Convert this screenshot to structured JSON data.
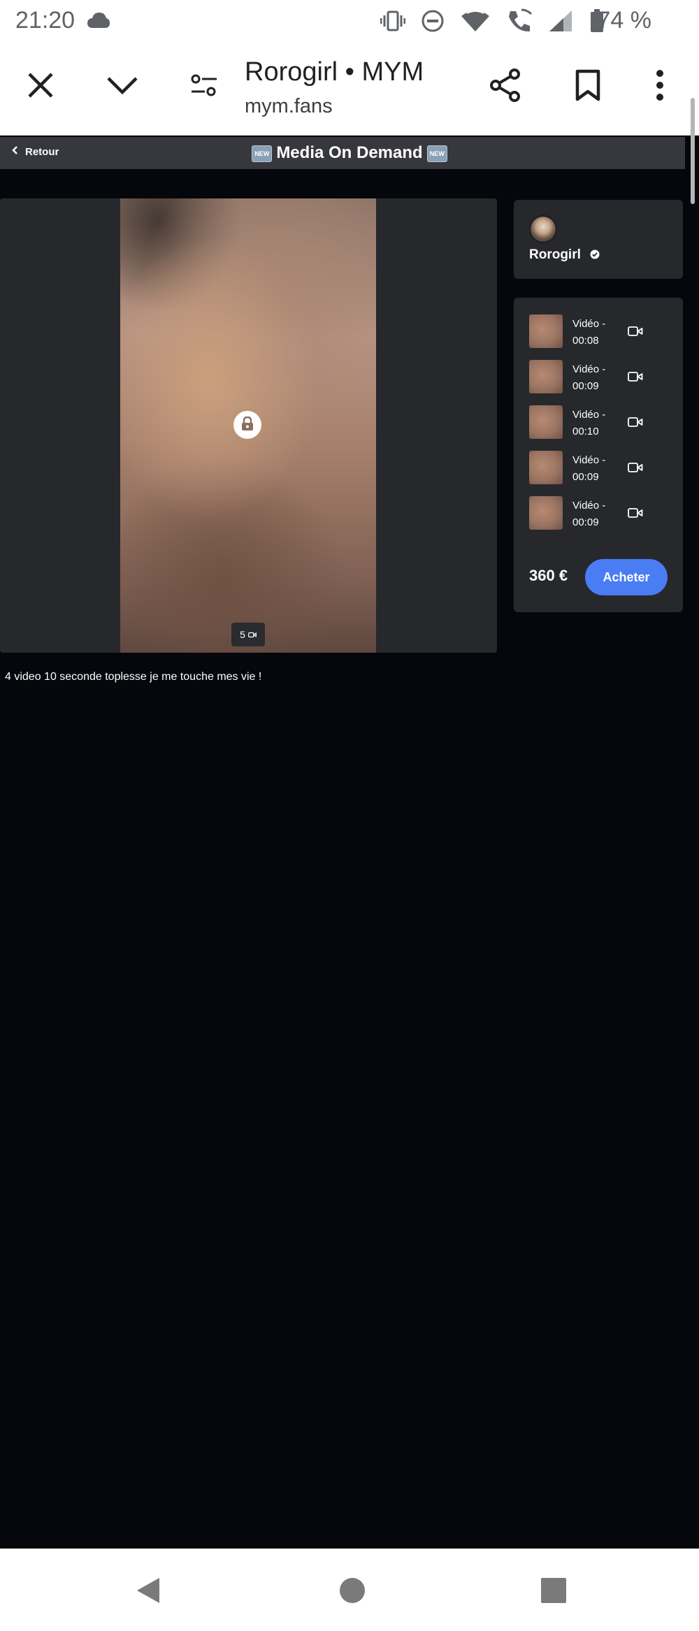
{
  "status_bar": {
    "time": "21:20",
    "battery_percent": "74 %",
    "icons": [
      "cloud-icon",
      "vibrate-icon",
      "do-not-disturb-icon",
      "wifi-icon",
      "wifi-calling-icon",
      "signal-icon",
      "battery-icon"
    ]
  },
  "toolbar": {
    "title": "Rorogirl • MYM",
    "url": "mym.fans",
    "icons": [
      "close-icon",
      "chevron-down-icon",
      "tune-icon",
      "share-icon",
      "bookmark-icon",
      "more-vert-icon"
    ]
  },
  "header": {
    "back_label": "Retour",
    "title": "Media On Demand",
    "badge_label": "NEW"
  },
  "media": {
    "count": "5"
  },
  "caption": "4 video 10 seconde toplesse je me touche mes vie !",
  "creator": {
    "name": "Rorogirl"
  },
  "items": [
    {
      "label": "Vidéo - 00:08"
    },
    {
      "label": "Vidéo - 00:09"
    },
    {
      "label": "Vidéo - 00:10"
    },
    {
      "label": "Vidéo - 00:09"
    },
    {
      "label": "Vidéo - 00:09"
    }
  ],
  "purchase": {
    "price": "360 €",
    "button_label": "Acheter"
  },
  "colors": {
    "background": "#05070c",
    "card": "#26282c",
    "accent": "#4a7cf4",
    "header_bar": "#36383d"
  }
}
